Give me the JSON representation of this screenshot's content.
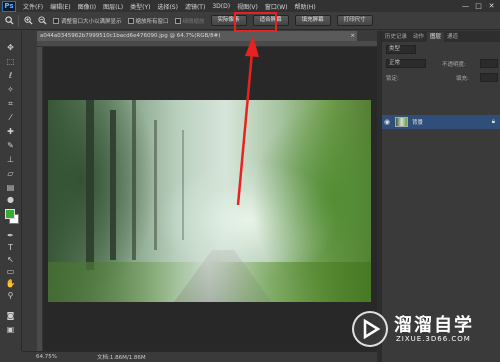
{
  "app": {
    "logo": "Ps"
  },
  "menu": [
    "文件(F)",
    "编辑(E)",
    "图像(I)",
    "图层(L)",
    "类型(Y)",
    "选择(S)",
    "滤镜(T)",
    "3D(D)",
    "视图(V)",
    "窗口(W)",
    "帮助(H)"
  ],
  "window_controls": [
    "—",
    "□",
    "✕"
  ],
  "options_bar": {
    "checkbox_1": "调整窗口大小以满屏显示",
    "checkbox_2": "缩放所有窗口",
    "scrubby": "细微缩放",
    "btn_actual": "实际像素",
    "btn_fit": "适合屏幕",
    "btn_fill": "填充屏幕",
    "btn_print": "打印尺寸"
  },
  "document": {
    "tab_title": "a044a0345962b7999510c1bacd6e476090.jpg @ 64.7%(RGB/8#)",
    "tab_close": "×"
  },
  "status": {
    "zoom": "64.75%",
    "doc": "文档:1.86M/1.86M"
  },
  "layers_panel": {
    "tabs": [
      "历史记录",
      "动作",
      "图层",
      "通道"
    ],
    "active_tab": "图层",
    "kind": "类型",
    "blend": "正常",
    "opacity_label": "不透明度:",
    "lock_label": "锁定:",
    "fill_label": "填充:",
    "layer_name": "背景"
  },
  "colors": {
    "foreground": "#3aaa35",
    "background": "#ffffff",
    "highlight": "#e8231f"
  },
  "watermark": {
    "title": "溜溜自学",
    "url": "ZIXUE.3D66.COM"
  }
}
